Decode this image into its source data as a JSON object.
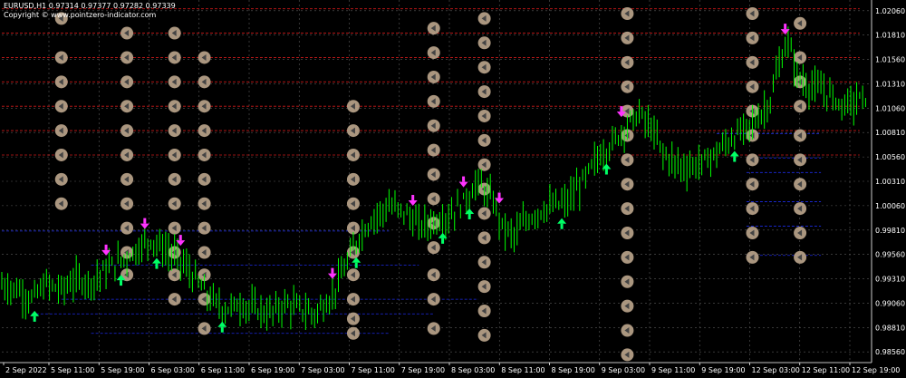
{
  "header": {
    "symbol_line": "EURUSD,H1  0.97314 0.97377 0.97282 0.97339",
    "copyright": "Copyright © www.pointzero-indicator.com"
  },
  "colors": {
    "background": "#000000",
    "candle": "#00ff00",
    "grid": "#5a5a5a",
    "resistance_line": "#ff2020",
    "support_line": "#2030ff",
    "marker_fill": "#b8a38a",
    "arrow_up": "#00ff66",
    "arrow_down": "#ff33ff"
  },
  "chart_data": {
    "type": "line",
    "price_ticks": [
      "1.02060",
      "1.01810",
      "1.01560",
      "1.01310",
      "1.01060",
      "1.00810",
      "1.00560",
      "1.00310",
      "1.00060",
      "0.99810",
      "0.99560",
      "0.99310",
      "0.99060",
      "0.98810",
      "0.98560"
    ],
    "time_ticks": [
      "2 Sep 2022",
      "5 Sep 11:00",
      "5 Sep 19:00",
      "6 Sep 03:00",
      "6 Sep 11:00",
      "6 Sep 19:00",
      "7 Sep 03:00",
      "7 Sep 11:00",
      "7 Sep 19:00",
      "8 Sep 03:00",
      "8 Sep 11:00",
      "8 Sep 19:00",
      "9 Sep 03:00",
      "9 Sep 11:00",
      "9 Sep 19:00",
      "12 Sep 03:00",
      "12 Sep 11:00",
      "12 Sep 19:00"
    ],
    "ylim": [
      0.9845,
      1.0217
    ],
    "grid": true,
    "price_anchors": [
      [
        0,
        0.9925
      ],
      [
        5,
        0.992
      ],
      [
        10,
        0.991
      ],
      [
        15,
        0.9925
      ],
      [
        20,
        0.992
      ],
      [
        25,
        0.993
      ],
      [
        30,
        0.9928
      ],
      [
        35,
        0.994
      ],
      [
        40,
        0.995
      ],
      [
        45,
        0.996
      ],
      [
        50,
        0.9972
      ],
      [
        55,
        0.996
      ],
      [
        60,
        0.995
      ],
      [
        65,
        0.993
      ],
      [
        70,
        0.991
      ],
      [
        75,
        0.99
      ],
      [
        80,
        0.9905
      ],
      [
        85,
        0.99
      ],
      [
        90,
        0.9895
      ],
      [
        95,
        0.9905
      ],
      [
        100,
        0.99
      ],
      [
        105,
        0.9895
      ],
      [
        110,
        0.991
      ],
      [
        115,
        0.994
      ],
      [
        120,
        0.9975
      ],
      [
        125,
        0.9995
      ],
      [
        130,
        1.0005
      ],
      [
        135,
        1.0
      ],
      [
        140,
        0.9985
      ],
      [
        145,
        0.999
      ],
      [
        150,
        0.9995
      ],
      [
        155,
        1.001
      ],
      [
        160,
        1.003
      ],
      [
        165,
        1.001
      ],
      [
        168,
        0.9985
      ],
      [
        172,
        0.9975
      ],
      [
        176,
        0.999
      ],
      [
        180,
        1.0
      ],
      [
        185,
        1.0005
      ],
      [
        190,
        1.001
      ],
      [
        195,
        1.003
      ],
      [
        200,
        1.0055
      ],
      [
        205,
        1.007
      ],
      [
        210,
        1.009
      ],
      [
        214,
        1.01
      ],
      [
        218,
        1.0085
      ],
      [
        222,
        1.006
      ],
      [
        226,
        1.005
      ],
      [
        230,
        1.0045
      ],
      [
        235,
        1.005
      ],
      [
        240,
        1.006
      ],
      [
        245,
        1.0075
      ],
      [
        250,
        1.0085
      ],
      [
        255,
        1.01
      ],
      [
        258,
        1.0115
      ],
      [
        261,
        1.015
      ],
      [
        264,
        1.0175
      ],
      [
        267,
        1.014
      ],
      [
        270,
        1.013
      ],
      [
        274,
        1.0125
      ],
      [
        278,
        1.012
      ],
      [
        282,
        1.011
      ],
      [
        286,
        1.0112
      ],
      [
        290,
        1.0118
      ]
    ],
    "arrows": [
      {
        "bar": 11,
        "dir": "up"
      },
      {
        "bar": 35,
        "dir": "down"
      },
      {
        "bar": 40,
        "dir": "up"
      },
      {
        "bar": 48,
        "dir": "down"
      },
      {
        "bar": 52,
        "dir": "up"
      },
      {
        "bar": 60,
        "dir": "down"
      },
      {
        "bar": 74,
        "dir": "up"
      },
      {
        "bar": 111,
        "dir": "down"
      },
      {
        "bar": 119,
        "dir": "up"
      },
      {
        "bar": 138,
        "dir": "down"
      },
      {
        "bar": 148,
        "dir": "up"
      },
      {
        "bar": 155,
        "dir": "down"
      },
      {
        "bar": 157,
        "dir": "up"
      },
      {
        "bar": 167,
        "dir": "down"
      },
      {
        "bar": 188,
        "dir": "up"
      },
      {
        "bar": 203,
        "dir": "up"
      },
      {
        "bar": 208,
        "dir": "down"
      },
      {
        "bar": 246,
        "dir": "up"
      },
      {
        "bar": 263,
        "dir": "down"
      }
    ],
    "resistance_levels": [
      {
        "from": 0,
        "to": 288,
        "price": 1.0208
      },
      {
        "from": 0,
        "to": 288,
        "price": 1.0183
      },
      {
        "from": 0,
        "to": 288,
        "price": 1.0158
      },
      {
        "from": 0,
        "to": 288,
        "price": 1.0133
      },
      {
        "from": 0,
        "to": 288,
        "price": 1.0108
      },
      {
        "from": 0,
        "to": 288,
        "price": 1.0083
      },
      {
        "from": 0,
        "to": 288,
        "price": 1.0058
      }
    ],
    "support_levels": [
      {
        "from": 0,
        "to": 130,
        "price": 0.998
      },
      {
        "from": 30,
        "to": 140,
        "price": 0.9945
      },
      {
        "from": 20,
        "to": 160,
        "price": 0.991
      },
      {
        "from": 10,
        "to": 145,
        "price": 0.9895
      },
      {
        "from": 30,
        "to": 130,
        "price": 0.9875
      },
      {
        "from": 240,
        "to": 275,
        "price": 1.008
      },
      {
        "from": 250,
        "to": 275,
        "price": 1.0055
      },
      {
        "from": 250,
        "to": 275,
        "price": 1.004
      },
      {
        "from": 250,
        "to": 275,
        "price": 1.001
      },
      {
        "from": 250,
        "to": 275,
        "price": 0.9985
      },
      {
        "from": 250,
        "to": 275,
        "price": 0.9955
      }
    ],
    "marker_columns": [
      {
        "bar": 20,
        "prices": [
          1.0198,
          1.0158,
          1.0133,
          1.0108,
          1.0083,
          1.0058,
          1.0033,
          1.0008
        ]
      },
      {
        "bar": 42,
        "prices": [
          1.0183,
          1.0158,
          1.0133,
          1.0108,
          1.0083,
          1.0058,
          1.0033,
          1.0008,
          0.9983,
          0.9958,
          0.9935
        ]
      },
      {
        "bar": 58,
        "prices": [
          1.0183,
          1.0158,
          1.0133,
          1.0108,
          1.0083,
          1.0058,
          1.0033,
          1.0008,
          0.9983,
          0.9958,
          0.9935,
          0.991
        ]
      },
      {
        "bar": 68,
        "prices": [
          1.0158,
          1.0133,
          1.0108,
          1.0083,
          1.0058,
          1.0033,
          1.0008,
          0.9983,
          0.9958,
          0.9935,
          0.991,
          0.988
        ]
      },
      {
        "bar": 118,
        "prices": [
          1.0108,
          1.0083,
          1.0058,
          1.0033,
          1.0008,
          0.9983,
          0.9958,
          0.9935,
          0.991,
          0.989,
          0.9875
        ]
      },
      {
        "bar": 145,
        "prices": [
          1.0188,
          1.0163,
          1.0138,
          1.0113,
          1.0088,
          1.0063,
          1.0038,
          1.0013,
          0.9988,
          0.9963,
          0.9935,
          0.991,
          0.988
        ]
      },
      {
        "bar": 162,
        "prices": [
          1.0198,
          1.0173,
          1.0148,
          1.0123,
          1.0098,
          1.0073,
          1.0048,
          1.0023,
          0.9998,
          0.9973,
          0.9948,
          0.9923,
          0.9898,
          0.9873
        ]
      },
      {
        "bar": 210,
        "prices": [
          1.0203,
          1.0178,
          1.0153,
          1.0128,
          1.0103,
          1.0078,
          1.0053,
          1.0028,
          1.0003,
          0.9978,
          0.9953,
          0.9928,
          0.9903,
          0.9878,
          0.9853
        ]
      },
      {
        "bar": 252,
        "prices": [
          1.0203,
          1.0178,
          1.0153,
          1.0128,
          1.0103,
          1.0078,
          1.0053,
          1.0028,
          1.0003,
          0.9978,
          0.9953
        ]
      },
      {
        "bar": 268,
        "prices": [
          1.0193,
          1.0158,
          1.0133,
          1.0108,
          1.0078,
          1.0053,
          1.0028,
          1.0003,
          0.9978,
          0.9953
        ]
      }
    ]
  }
}
